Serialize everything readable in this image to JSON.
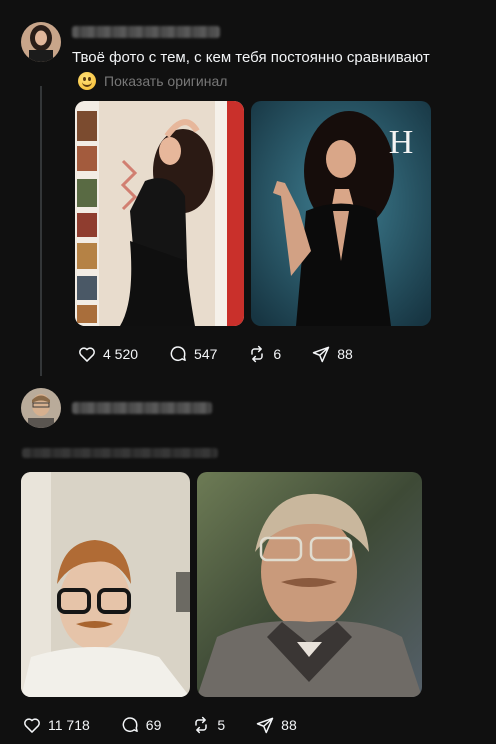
{
  "posts": [
    {
      "text": "Твоё фото с тем, с кем тебя постоянно сравнивают",
      "translate_label": "Показать оригинал",
      "likes": "4 520",
      "comments": "547",
      "reposts": "6",
      "shares": "88",
      "photo_badge": "H"
    },
    {
      "likes": "11 718",
      "comments": "69",
      "reposts": "5",
      "shares": "88"
    }
  ],
  "icons": {
    "like": "heart-icon",
    "comment": "comment-icon",
    "repost": "repost-icon",
    "share": "share-icon"
  },
  "colors": {
    "background": "#101010",
    "text": "#f3f5f7",
    "muted": "#777777"
  }
}
